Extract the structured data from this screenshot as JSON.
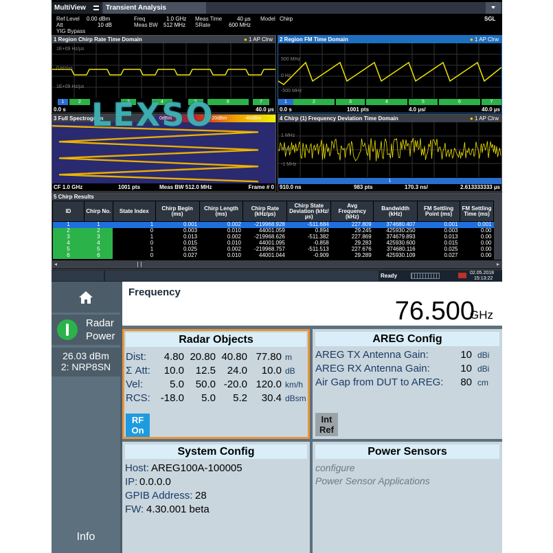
{
  "analyzer": {
    "tabs": {
      "multiview": "MultiView",
      "multiview_icon": "grid-icon",
      "transient": "Transient Analysis"
    },
    "mode": "SGL",
    "params": {
      "ref_level_label": "Ref Level",
      "ref_level": "0.00 dBm",
      "att_label": "Att",
      "att": "10 dB",
      "yig": "YIG Bypass",
      "freq_label": "Freq",
      "freq": "1.0 GHz",
      "meas_bw_label": "Meas BW",
      "meas_bw": "512 MHz",
      "meas_time_label": "Meas Time",
      "meas_time": "40 µs",
      "srate_label": "SRate",
      "srate": "600 MHz",
      "model_label": "Model",
      "model": "Chirp"
    },
    "win1": {
      "title": "1 Region Chirp Rate Time Domain",
      "trace": "1 AP Clrw",
      "y_labels": [
        "1E+09 Hz/µs",
        "0 Hz/µs",
        "1E+09 Hz/µs"
      ],
      "segments": [
        "1",
        "2",
        "3",
        "4",
        "5",
        "6",
        "7"
      ],
      "footer_left": "0.0 s",
      "footer_right": "40.0 µs"
    },
    "win2": {
      "title": "2 Region FM Time Domain",
      "trace": "1 AP Clrw",
      "y_labels": [
        "500 MHz",
        "0 Hz",
        "-500 MHz"
      ],
      "segments": [
        "1",
        "2",
        "3",
        "4",
        "5",
        "6",
        "7"
      ],
      "footer_left": "0.0 s",
      "footer_mid": "1001 pts",
      "footer_div": "4.0 µs/",
      "footer_right": "40.0 µs"
    },
    "win3": {
      "title": "3 Full Spectrogram",
      "scale": [
        "0dBm",
        "-20dBm",
        "-40dBm"
      ],
      "footer_cf": "CF 1.0 GHz",
      "footer_pts": "1001 pts",
      "footer_bw": "Meas BW 512.0 MHz",
      "footer_frame": "Frame # 0"
    },
    "win4": {
      "title": "4 Chirp (1) Frequency Deviation Time Domain",
      "trace": "1 AP Clrw",
      "y_labels": [
        "1 MHz",
        "0 Hz",
        "-1 MHz"
      ],
      "marker": "1",
      "footer_left": "910.0 ns",
      "footer_pts": "983 pts",
      "footer_div": "170.3 ns/",
      "footer_right": "2.613333333 µs"
    },
    "win5": {
      "title": "5 Chirp Results",
      "columns": [
        "ID",
        "Chirp No.",
        "State Index",
        "Chirp Begin (ms)",
        "Chirp Length (ms)",
        "Chirp Rate (kHz/µs)",
        "Chirp State Deviation (kHz/µs)",
        "Avg Frequency (kHz)",
        "Bandwidth (kHz)",
        "FM Settling Point (ms)",
        "FM Settling Time (ms)"
      ],
      "rows": [
        [
          "1",
          "1",
          "1",
          "0.001",
          "0.002",
          "-219968.928",
          "-511.684",
          "227.809",
          "374680.407",
          "0.001",
          "0.001"
        ],
        [
          "2",
          "2",
          "0",
          "0.003",
          "0.010",
          "44001.059",
          "0.894",
          "29.245",
          "425930.250",
          "0.003",
          "0.00"
        ],
        [
          "3",
          "3",
          "1",
          "0.013",
          "0.002",
          "-219968.626",
          "-511.382",
          "227.869",
          "374679.893",
          "0.013",
          "0.00"
        ],
        [
          "4",
          "4",
          "0",
          "0.015",
          "0.010",
          "44001.095",
          "-0.858",
          "29.283",
          "425930.600",
          "0.015",
          "0.00"
        ],
        [
          "5",
          "5",
          "1",
          "0.025",
          "0.002",
          "-219968.757",
          "-511.513",
          "227.676",
          "374680.116",
          "0.025",
          "0.00"
        ],
        [
          "6",
          "6",
          "0",
          "0.027",
          "0.010",
          "44001.044",
          "-0.909",
          "29.289",
          "425930.109",
          "0.027",
          "0.00"
        ]
      ]
    }
  },
  "status": {
    "ready": "Ready",
    "date": "02.05.2018",
    "time": "15:13:22"
  },
  "watermark": "LEXSO",
  "sidebar": {
    "home_icon": "home-icon",
    "radar_label_1": "Radar",
    "radar_label_2": "Power",
    "power_value": "26.03 dBm",
    "sensor": "2: NRP8SN",
    "info": "Info"
  },
  "frequency": {
    "label": "Frequency",
    "value": "76.500",
    "unit": "GHz"
  },
  "radar_objects": {
    "title": "Radar Objects",
    "rows": [
      {
        "label": "Dist:",
        "values": [
          "4.80",
          "20.80",
          "40.80",
          "77.80"
        ],
        "unit": "m"
      },
      {
        "label": "Σ Att:",
        "values": [
          "10.0",
          "12.5",
          "24.0",
          "10.0"
        ],
        "unit": "dB"
      },
      {
        "label": "Vel:",
        "values": [
          "5.0",
          "50.0",
          "-20.0",
          "120.0"
        ],
        "unit": "km/h"
      },
      {
        "label": "RCS:",
        "values": [
          "-18.0",
          "5.0",
          "5.2",
          "30.4"
        ],
        "unit": "dBsm"
      }
    ],
    "rf_button_1": "RF",
    "rf_button_2": "On"
  },
  "areg_config": {
    "title": "AREG Config",
    "rows": [
      {
        "label": "AREG TX Antenna Gain:",
        "value": "10",
        "unit": "dBi"
      },
      {
        "label": "AREG RX Antenna Gain:",
        "value": "10",
        "unit": "dBi"
      },
      {
        "label": "Air Gap from DUT to AREG:",
        "value": "80",
        "unit": "cm"
      }
    ],
    "ref_button_1": "Int",
    "ref_button_2": "Ref"
  },
  "system_config": {
    "title": "System Config",
    "host_label": "Host:",
    "host": "AREG100A-100005",
    "ip_label": "IP:",
    "ip": "0.0.0.0",
    "gpib_label": "GPIB Address:",
    "gpib": "28",
    "fw_label": "FW:",
    "fw": "4.30.001 beta"
  },
  "power_sensors": {
    "title": "Power Sensors",
    "item_1": "configure",
    "item_2": "Power Sensor Applications"
  },
  "colors": {
    "accent_orange": "#e8953a",
    "rf_blue": "#1e9be0",
    "trace_yellow": "#f2e600",
    "seg_green": "#2bb34a"
  }
}
